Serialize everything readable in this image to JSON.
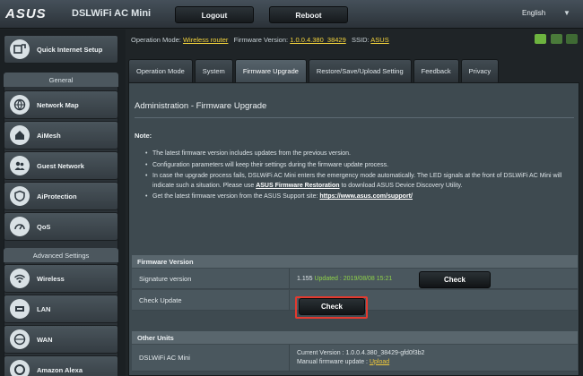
{
  "header": {
    "brand": "ASUS",
    "model": "DSLWiFi AC Mini",
    "logout_label": "Logout",
    "reboot_label": "Reboot",
    "language": "English",
    "language_caret": "▼"
  },
  "status": {
    "op_mode_label": "Operation Mode:",
    "op_mode_value": "Wireless router",
    "firmware_label": "Firmware Version:",
    "firmware_value": "1.0.0.4.380_38429",
    "ssid_label": "SSID:",
    "ssid_value": "ASUS"
  },
  "sidebar": {
    "quick_setup": "Quick Internet Setup",
    "general_header": "General",
    "general_items": [
      {
        "label": "Network Map",
        "icon": "globe-icon"
      },
      {
        "label": "AiMesh",
        "icon": "house-icon"
      },
      {
        "label": "Guest Network",
        "icon": "people-icon"
      },
      {
        "label": "AiProtection",
        "icon": "shield-icon"
      },
      {
        "label": "QoS",
        "icon": "speedometer-icon"
      }
    ],
    "advanced_header": "Advanced Settings",
    "advanced_items": [
      {
        "label": "Wireless",
        "icon": "wifi-icon"
      },
      {
        "label": "LAN",
        "icon": "lan-icon"
      },
      {
        "label": "WAN",
        "icon": "globe-icon"
      },
      {
        "label": "Amazon Alexa",
        "icon": "alexa-icon"
      }
    ]
  },
  "tabs": [
    {
      "label": "Operation Mode",
      "active": false
    },
    {
      "label": "System",
      "active": false
    },
    {
      "label": "Firmware Upgrade",
      "active": true
    },
    {
      "label": "Restore/Save/Upload Setting",
      "active": false
    },
    {
      "label": "Feedback",
      "active": false
    },
    {
      "label": "Privacy",
      "active": false
    }
  ],
  "main": {
    "title": "Administration - Firmware Upgrade",
    "note_label": "Note:",
    "notes": [
      "The latest firmware version includes updates from the previous version.",
      "Configuration parameters will keep their settings during the firmware update process.",
      "In case the upgrade process fails, DSLWiFi AC Mini enters the emergency mode automatically. The LED signals at the front of DSLWiFi AC Mini will indicate such a situation. Please use",
      "Get the latest firmware version from the ASUS Support site:"
    ],
    "note3_link": "ASUS Firmware Restoration",
    "note3_tail": "to download ASUS Device Discovery Utility.",
    "note4_link": "https://www.asus.com/support/",
    "firmware_section": "Firmware Version",
    "signature_label": "Signature version",
    "signature_value": "1.155",
    "signature_status": "Updated : 2019/08/08 15:21",
    "signature_check": "Check",
    "check_update_label": "Check Update",
    "check_update_btn": "Check",
    "other_section": "Other Units",
    "unit_label": "DSLWiFi AC Mini",
    "unit_current": "Current Version : 1.0.0.4.380_38429-gfd0f3b2",
    "unit_manual_label": "Manual firmware update :",
    "unit_upload": "Upload"
  },
  "colors": {
    "highlight": "#e33a2f",
    "link_yellow": "#f5d53d",
    "status_green": "#8fd24a"
  }
}
